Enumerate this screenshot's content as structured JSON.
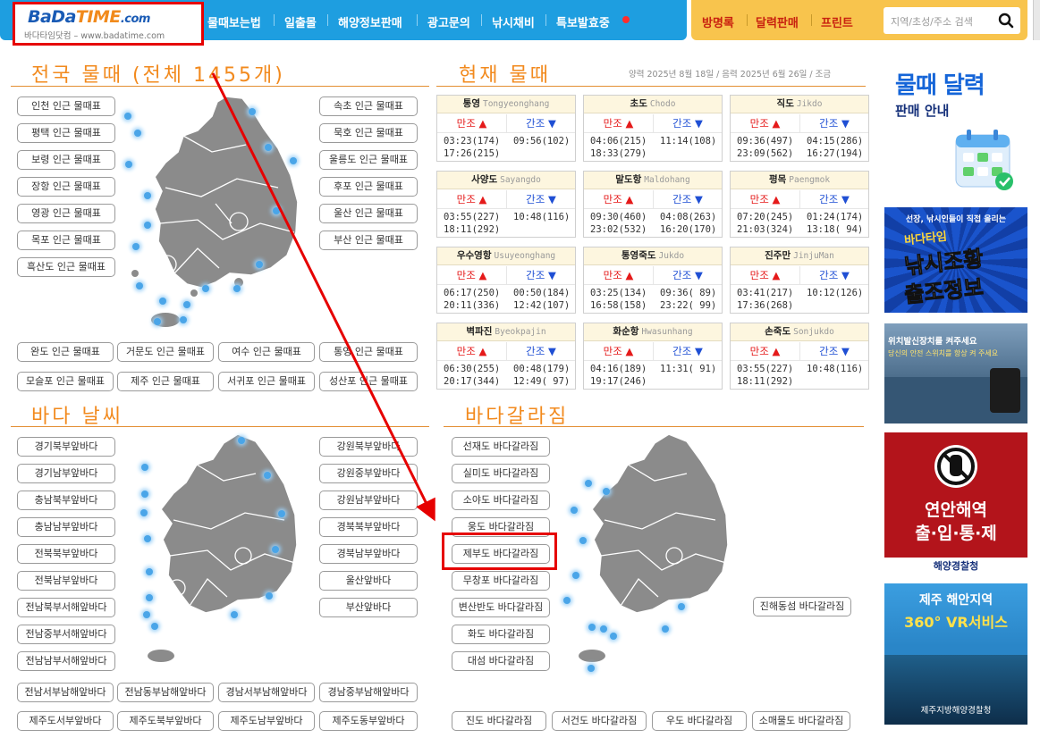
{
  "header": {
    "logo_text": {
      "ba": "BaDa",
      "time": "TIME",
      "dotcom": ".com"
    },
    "logo_sub": "바다타임닷컴 – www.badatime.com",
    "nav": [
      "물때보는법",
      "일출몰",
      "해양정보판매",
      "광고문의",
      "낚시채비",
      "특보발효중"
    ],
    "right_nav": [
      "방명록",
      "달력판매",
      "프린트"
    ],
    "search_placeholder": "지역/초성/주소 검색"
  },
  "sections": {
    "tides_all": "전국 물때 (전체 1455개)",
    "tides_now": "현재 물때",
    "date_info": "양력 2025년 8월 18일 / 음력 2025년 6월 26일 / 조금",
    "sea_weather": "바다 날씨",
    "sea_fishing": "바다갈라짐"
  },
  "tide_region_left": [
    "인천 인근 물때표",
    "평택 인근 물때표",
    "보령 인근 물때표",
    "장항 인근 물때표",
    "영광 인근 물때표",
    "목포 인근 물때표",
    "흑산도 인근 물때표"
  ],
  "tide_region_right": [
    "속초 인근 물때표",
    "묵호 인근 물때표",
    "울릉도 인근 물때표",
    "후포 인근 물때표",
    "울산 인근 물때표",
    "부산 인근 물때표"
  ],
  "tide_region_bottom": [
    "완도 인근 물때표",
    "거문도 인근 물때표",
    "여수 인근 물때표",
    "통영 인근 물때표",
    "모슬포 인근 물때표",
    "제주 인근 물때표",
    "서귀포 인근 물때표",
    "성산포 인근 물때표"
  ],
  "tide_cards_labels": {
    "high": "만조 ▲",
    "low": "간조 ▼"
  },
  "tide_cards": [
    {
      "name": "통영",
      "roman": "Tongyeonghang",
      "high": "03:23(174)\n17:26(215)",
      "low": "09:56(102)"
    },
    {
      "name": "초도",
      "roman": "Chodo",
      "high": "04:06(215)\n18:33(279)",
      "low": "11:14(108)"
    },
    {
      "name": "직도",
      "roman": "Jikdo",
      "high": "09:36(497)\n23:09(562)",
      "low": "04:15(286)\n16:27(194)"
    },
    {
      "name": "사양도",
      "roman": "Sayangdo",
      "high": "03:55(227)\n18:11(292)",
      "low": "10:48(116)"
    },
    {
      "name": "말도항",
      "roman": "Maldohang",
      "high": "09:30(460)\n23:02(532)",
      "low": "04:08(263)\n16:20(170)"
    },
    {
      "name": "평목",
      "roman": "Paengmok",
      "high": "07:20(245)\n21:03(324)",
      "low": "01:24(174)\n13:18( 94)"
    },
    {
      "name": "우수영항",
      "roman": "Usuyeonghang",
      "high": "06:17(250)\n20:11(336)",
      "low": "00:50(184)\n12:42(107)"
    },
    {
      "name": "통영죽도",
      "roman": "Jukdo",
      "high": "03:25(134)\n16:58(158)",
      "low": "09:36( 89)\n23:22( 99)"
    },
    {
      "name": "진주만",
      "roman": "JinjuMan",
      "high": "03:41(217)\n17:36(268)",
      "low": "10:12(126)"
    },
    {
      "name": "벽파진",
      "roman": "Byeokpajin",
      "high": "06:30(255)\n20:17(344)",
      "low": "00:48(179)\n12:49( 97)"
    },
    {
      "name": "화순항",
      "roman": "Hwasunhang",
      "high": "04:16(189)\n19:17(246)",
      "low": "11:31( 91)"
    },
    {
      "name": "손죽도",
      "roman": "Sonjukdo",
      "high": "03:55(227)\n18:11(292)",
      "low": "10:48(116)"
    }
  ],
  "weather_left": [
    "경기북부앞바다",
    "경기남부앞바다",
    "충남북부앞바다",
    "충남남부앞바다",
    "전북북부앞바다",
    "전북남부앞바다",
    "전남북부서해앞바다",
    "전남중부서해앞바다",
    "전남남부서해앞바다"
  ],
  "weather_right": [
    "강원북부앞바다",
    "강원중부앞바다",
    "강원남부앞바다",
    "경북북부앞바다",
    "경북남부앞바다",
    "울산앞바다",
    "부산앞바다"
  ],
  "weather_bottom": [
    "전남서부남해앞바다",
    "전남동부남해앞바다",
    "경남서부남해앞바다",
    "경남중부남해앞바다",
    "제주도서부앞바다",
    "제주도북부앞바다",
    "제주도남부앞바다",
    "제주도동부앞바다"
  ],
  "sea_part_left": [
    "선재도 바다갈라짐",
    "실미도 바다갈라짐",
    "소야도 바다갈라짐",
    "웅도 바다갈라짐",
    "제부도 바다갈라짐",
    "무창포 바다갈라짐",
    "변산반도 바다갈라짐",
    "화도 바다갈라짐",
    "대섬 바다갈라짐"
  ],
  "sea_part_right": [
    "진해동섬 바다갈라짐"
  ],
  "sea_part_bottom": [
    "진도 바다갈라짐",
    "서건도 바다갈라짐",
    "우도 바다갈라짐",
    "소매물도 바다갈라짐"
  ],
  "ads": {
    "calendar": {
      "title": "물때 달력",
      "sub": "판매 안내"
    },
    "fishing": {
      "top": "선장, 낚시인들이 직접 올리는",
      "brand": "바다타임",
      "l1": "낚시조황",
      "l2": "출조정보"
    },
    "locator": {
      "top": "위치발신장치를 켜주세요",
      "sub": "당신의 안전 스위치를 항상 켜 주세요"
    },
    "restrict": {
      "l1": "연안해역",
      "l2": "출·입·통·제",
      "org": "해양경찰청"
    },
    "jeju": {
      "l1": "제주 해안지역",
      "l2": "360° VR서비스",
      "org": "제주지방해양경찰청"
    }
  },
  "colors": {
    "nav_blue": "#1e9ee0",
    "nav_yellow": "#f8c44d",
    "title_orange": "#f28a1e",
    "map_gray": "#8b8b8b",
    "pin_blue": "#4aa5e8",
    "annotation_red": "#e60000"
  }
}
